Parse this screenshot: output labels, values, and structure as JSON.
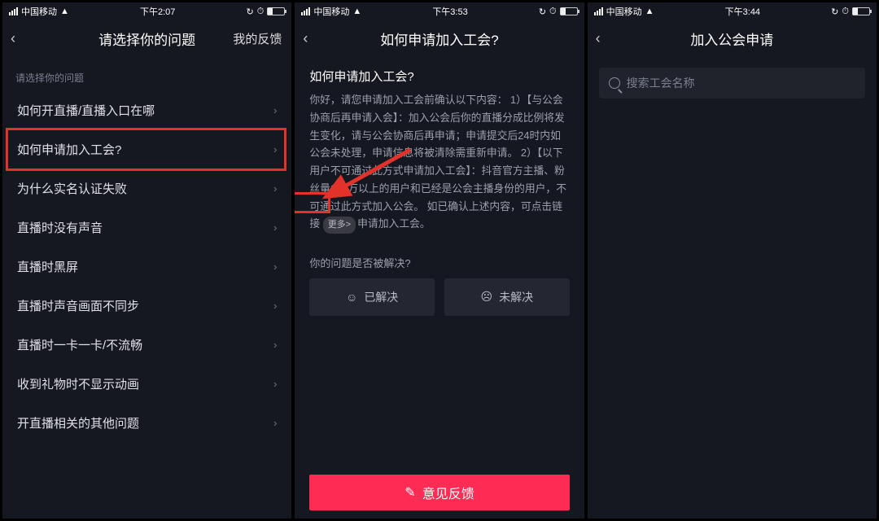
{
  "screen1": {
    "status": {
      "carrier": "中国移动",
      "time": "下午2:07"
    },
    "nav": {
      "title": "请选择你的问题",
      "right": "我的反馈"
    },
    "caption": "请选择你的问题",
    "items": [
      "如何开直播/直播入口在哪",
      "如何申请加入工会?",
      "为什么实名认证失败",
      "直播时没有声音",
      "直播时黑屏",
      "直播时声音画面不同步",
      "直播时一卡一卡/不流畅",
      "收到礼物时不显示动画",
      "开直播相关的其他问题"
    ],
    "highlight_index": 1
  },
  "screen2": {
    "status": {
      "carrier": "中国移动",
      "time": "下午3:53"
    },
    "nav": {
      "title": "如何申请加入工会?"
    },
    "article_title": "如何申请加入工会?",
    "body_pre": "你好，请您申请加入工会前确认以下内容： 1）【与公会协商后再申请入会】：加入公会后你的直播分成比例将发生变化，请与公会协商后再申请；申请提交后24时内如公会未处理，申请信息将被清除需重新申请。 2）【以下用户不可通过此方式申请加入工会】：抖音官方主播、粉丝量100万以上的用户和已经是公会主播身份的用户，不可通过此方式加入公会。 如已确认上述内容，可点击链接",
    "more_label": "更多>",
    "body_post": "申请加入工会。",
    "resolve_q": "你的问题是否被解决?",
    "ok_label": "已解决",
    "no_label": "未解决",
    "feedback": "意见反馈"
  },
  "screen3": {
    "status": {
      "carrier": "中国移动",
      "time": "下午3:44"
    },
    "nav": {
      "title": "加入公会申请"
    },
    "search_placeholder": "搜索工会名称"
  }
}
